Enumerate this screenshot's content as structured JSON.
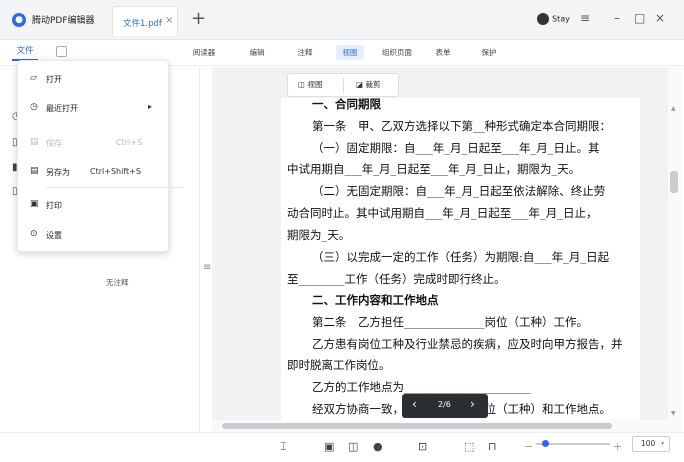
{
  "titlebar": {
    "app_name": "腾动PDF编辑器",
    "tab_label": "文件1.pdf",
    "tab_close": "×",
    "new_tab": "+",
    "user_name": "Stay",
    "menu_icon": "≡",
    "minimize": "–",
    "maximize": "□",
    "close": "×"
  },
  "menubar": {
    "file": "文件",
    "tabs": [
      "阅读器",
      "编辑",
      "注释",
      "视图",
      "组织页面",
      "表单",
      "保护"
    ],
    "active_tab": "视图"
  },
  "file_menu": {
    "items": [
      {
        "icon": "folder-open-icon",
        "label": "打开",
        "shortcut": "",
        "disabled": false
      },
      {
        "icon": "clock-icon",
        "label": "最近打开",
        "shortcut": "",
        "submenu": true,
        "disabled": false
      },
      {
        "icon": "save-icon",
        "label": "保存",
        "shortcut": "Ctrl+S",
        "disabled": true
      },
      {
        "icon": "save-as-icon",
        "label": "另存为",
        "shortcut": "Ctrl+Shift+S",
        "disabled": false
      },
      {
        "icon": "print-icon",
        "label": "打印",
        "shortcut": "",
        "disabled": false
      },
      {
        "icon": "settings-icon",
        "label": "设置",
        "shortcut": "",
        "disabled": false
      }
    ]
  },
  "sidebar": {
    "empty_text": "无注释"
  },
  "view_bar": {
    "view_label": "视图",
    "crop_label": "裁剪"
  },
  "document": {
    "lines": [
      "一、合同期限",
      "第一条　甲、乙双方选择以下第__种形式确定本合同期限：",
      "（一）固定期限：自___年_月_日起至___年_月_日止。其",
      "中试用期自___年_月_日起至___年_月_日止，期限为_天。",
      "（二）无固定期限：自___年_月_日起至依法解除、终止劳",
      "动合同时止。其中试用期自___年_月_日起至___年_月_日止，",
      "期限为_天。",
      "（三）以完成一定的工作（任务）为期限:自___年_月_日起",
      "至________工作（任务）完成时即行终止。",
      "二、工作内容和工作地点",
      "第二条　乙方担任______________岗位（工种）工作。",
      "乙方患有岗位工种及行业禁忌的疾病，应及时向甲方报告，并",
      "即时脱离工作岗位。",
      "乙方的工作地点为______________________",
      "经双方协商一致，可以变更工作岗位（工种）和工作地点。"
    ]
  },
  "pager": {
    "prev": "‹",
    "page": "2/6",
    "next": "›"
  },
  "zoom": {
    "minus": "−",
    "plus": "+",
    "value": "100",
    "level_fraction": 0.12
  },
  "colors": {
    "accent": "#2d6be4"
  }
}
